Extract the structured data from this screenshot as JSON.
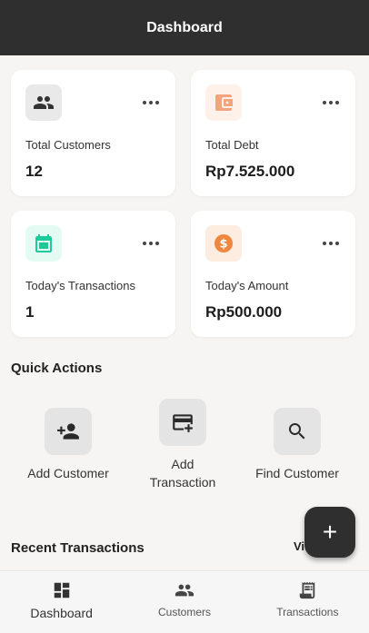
{
  "header": {
    "title": "Dashboard"
  },
  "stats": [
    {
      "label": "Total Customers",
      "value": "12",
      "icon": "people-icon",
      "icon_bg": "#e9e9e9",
      "icon_color": "#333333"
    },
    {
      "label": "Total Debt",
      "value": "Rp7.525.000",
      "icon": "wallet-icon",
      "icon_bg": "#fdf1ea",
      "icon_color": "#f2a57c"
    },
    {
      "label": "Today's Transactions",
      "value": "1",
      "icon": "calendar-icon",
      "icon_bg": "#e4fbf4",
      "icon_color": "#1ec99a"
    },
    {
      "label": "Today's Amount",
      "value": "Rp500.000",
      "icon": "dollar-coin-icon",
      "icon_bg": "#fdece0",
      "icon_color": "#f0873e"
    }
  ],
  "quick_actions": {
    "title": "Quick Actions",
    "items": [
      {
        "label": "Add Customer",
        "icon": "person-add-icon"
      },
      {
        "label": "Add Transaction",
        "icon": "card-add-icon"
      },
      {
        "label": "Find Customer",
        "icon": "search-icon"
      }
    ]
  },
  "recent": {
    "title": "Recent Transactions",
    "link": "Vi"
  },
  "fab": {
    "label": "+"
  },
  "bottom_nav": [
    {
      "label": "Dashboard",
      "icon": "dashboard-icon",
      "active": true
    },
    {
      "label": "Customers",
      "icon": "people-icon",
      "active": false
    },
    {
      "label": "Transactions",
      "icon": "receipt-icon",
      "active": false
    }
  ]
}
